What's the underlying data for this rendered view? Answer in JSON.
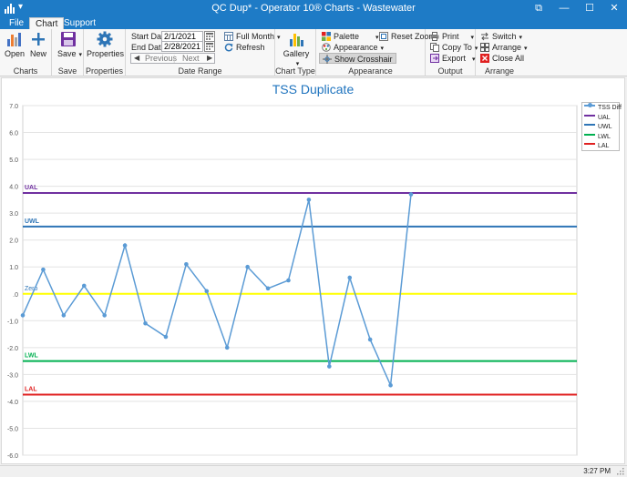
{
  "window": {
    "title": "QC Dup* - Operator 10® Charts - Wastewater",
    "quick_access": "▾",
    "controls": {
      "pin": "⧉",
      "minimize": "—",
      "maximize": "☐",
      "close": "✕"
    }
  },
  "tabs": [
    {
      "label": "File"
    },
    {
      "label": "Chart"
    },
    {
      "label": "Support"
    }
  ],
  "ribbon": {
    "charts": {
      "label": "Charts",
      "open": "Open",
      "new": "New"
    },
    "save": {
      "label": "Save",
      "save": "Save"
    },
    "properties": {
      "label": "Properties",
      "properties": "Properties"
    },
    "date_range": {
      "label": "Date Range",
      "start_label": "Start Date:",
      "start_value": "2/1/2021",
      "end_label": "End Date:",
      "end_value": "2/28/2021",
      "period": "Full Month",
      "refresh": "Refresh",
      "previous": "Previous",
      "next": "Next"
    },
    "chart_type": {
      "label": "Chart Type",
      "gallery": "Gallery"
    },
    "appearance": {
      "label": "Appearance",
      "palette": "Palette",
      "appearance": "Appearance",
      "show_crosshair": "Show Crosshair",
      "reset_zoom": "Reset Zoom"
    },
    "output": {
      "label": "Output",
      "print": "Print",
      "copy_to": "Copy To",
      "export": "Export"
    },
    "arrange": {
      "label": "Arrange",
      "switch": "Switch",
      "arrange": "Arrange",
      "close_all": "Close All"
    }
  },
  "chart_data": {
    "type": "line",
    "title": "TSS Duplicate",
    "xlabel": "",
    "ylabel": "",
    "ylim": [
      -6,
      7
    ],
    "yticks": [
      "7.0",
      "6.0",
      "5.0",
      "4.0",
      "3.0",
      "2.0",
      "1.0",
      ".0",
      "-1.0",
      "-2.0",
      "-3.0",
      "-4.0",
      "-5.0",
      "-6.0"
    ],
    "grid": true,
    "legend_position": "top-right",
    "series": [
      {
        "name": "TSS Diff",
        "color": "#5b9bd5",
        "x": [
          0,
          1,
          2,
          3,
          4,
          5,
          6,
          7,
          8,
          9,
          10,
          11,
          12,
          13,
          14,
          15,
          16,
          17,
          18,
          19
        ],
        "y": [
          -0.8,
          0.9,
          -0.8,
          0.3,
          -0.8,
          1.8,
          -1.1,
          -1.6,
          1.1,
          0.1,
          -2.0,
          1.0,
          0.2,
          0.5,
          3.5,
          -2.7,
          0.6,
          -1.7,
          -3.4,
          3.7
        ]
      }
    ],
    "control_lines": [
      {
        "name": "UAL",
        "value": 3.75,
        "color": "#7030a0"
      },
      {
        "name": "UWL",
        "value": 2.5,
        "color": "#2e75b6"
      },
      {
        "name": "Zero",
        "value": 0,
        "color": "#ffff00"
      },
      {
        "name": "LWL",
        "value": -2.5,
        "color": "#00b050"
      },
      {
        "name": "LAL",
        "value": -3.75,
        "color": "#e02020"
      }
    ],
    "legend": [
      "TSS Diff",
      "UAL",
      "UWL",
      "LWL",
      "LAL"
    ]
  },
  "status": {
    "time": "3:27 PM"
  }
}
